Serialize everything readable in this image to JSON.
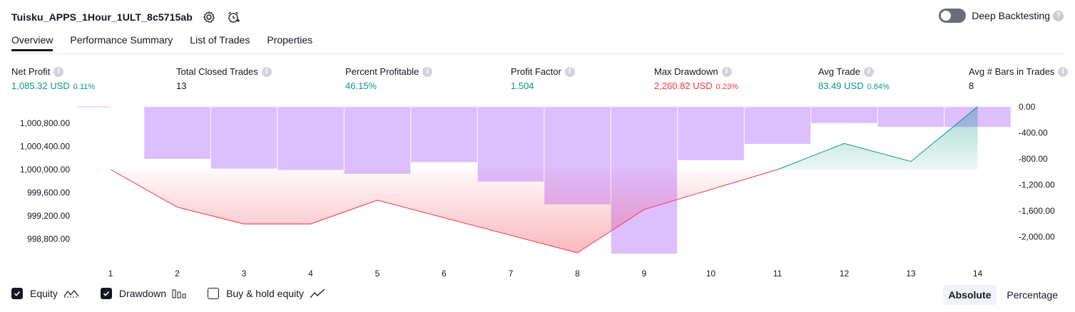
{
  "header": {
    "strategy_name": "Tuisku_APPS_1Hour_1ULT_8c5715ab",
    "settings_icon": "gear-icon",
    "alert_icon": "alarm-clock-plus-icon",
    "deep_backtesting_label": "Deep Backtesting",
    "deep_backtesting_enabled": false,
    "help_glyph": "?"
  },
  "tabs": [
    {
      "label": "Overview",
      "active": true
    },
    {
      "label": "Performance Summary",
      "active": false
    },
    {
      "label": "List of Trades",
      "active": false
    },
    {
      "label": "Properties",
      "active": false
    }
  ],
  "metrics": [
    {
      "label": "Net Profit",
      "value": "1,085.32 USD",
      "pct": "0.11%",
      "tone": "pos"
    },
    {
      "label": "Total Closed Trades",
      "value": "13",
      "pct": "",
      "tone": "neu"
    },
    {
      "label": "Percent Profitable",
      "value": "46.15%",
      "pct": "",
      "tone": "pos"
    },
    {
      "label": "Profit Factor",
      "value": "1.504",
      "pct": "",
      "tone": "pos"
    },
    {
      "label": "Max Drawdown",
      "value": "2,260.82 USD",
      "pct": "0.23%",
      "tone": "neg"
    },
    {
      "label": "Avg Trade",
      "value": "83.49 USD",
      "pct": "0.84%",
      "tone": "pos"
    },
    {
      "label": "Avg # Bars in Trades",
      "value": "8",
      "pct": "",
      "tone": "neu"
    }
  ],
  "info_glyph": "i",
  "chart_data": {
    "type": "line",
    "x": [
      1,
      2,
      3,
      4,
      5,
      6,
      7,
      8,
      9,
      10,
      11,
      12,
      13,
      14
    ],
    "x_tick_labels": [
      "1",
      "2",
      "3",
      "4",
      "5",
      "6",
      "7",
      "8",
      "9",
      "10",
      "11",
      "12",
      "13",
      "14"
    ],
    "series": [
      {
        "name": "Equity",
        "axis": "left",
        "values": [
          1000000.0,
          999350.0,
          999060.0,
          999060.0,
          999470.0,
          null,
          null,
          998560.0,
          999310.0,
          null,
          1000000.0,
          1000450.0,
          1000140.0,
          1001085.32
        ]
      },
      {
        "name": "Drawdown",
        "axis": "right",
        "kind": "bar",
        "values": [
          0,
          -800,
          -950,
          -970,
          -1030,
          -850,
          -1150,
          -1500,
          -2260.82,
          -820,
          -570,
          -250,
          -310,
          -310
        ]
      }
    ],
    "y_left": {
      "ticks": [
        "1,000,800.00",
        "1,000,400.00",
        "1,000,000.00",
        "999,600.00",
        "999,200.00",
        "998,800.00"
      ],
      "tick_values": [
        1000800,
        1000400,
        1000000,
        999600,
        999200,
        998800
      ]
    },
    "y_right": {
      "ticks": [
        "0.00",
        "-400.00",
        "-800.00",
        "-1,200.00",
        "-1,600.00",
        "-2,000.00"
      ],
      "tick_values": [
        0,
        -400,
        -800,
        -1200,
        -1600,
        -2000
      ]
    },
    "colors": {
      "profit": "#089981",
      "loss": "#f23645",
      "drawdown": "#d1a8ff"
    }
  },
  "legend": [
    {
      "label": "Equity",
      "checked": true,
      "icon": "line-chart-icon"
    },
    {
      "label": "Drawdown",
      "checked": true,
      "icon": "bar-chart-icon"
    },
    {
      "label": "Buy & hold equity",
      "checked": false,
      "icon": "trend-line-icon"
    }
  ],
  "modes": [
    {
      "label": "Absolute",
      "active": true
    },
    {
      "label": "Percentage",
      "active": false
    }
  ]
}
